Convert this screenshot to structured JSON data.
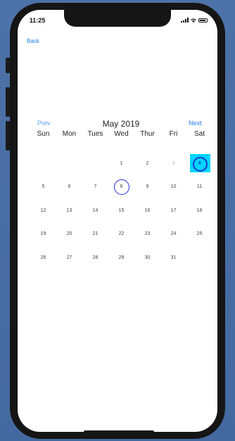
{
  "status_bar": {
    "time": "11:25"
  },
  "nav": {
    "back_label": "Back"
  },
  "calendar": {
    "prev_label": "Prev",
    "next_label": "Next",
    "month_title": "May 2019",
    "weekdays": [
      "Sun",
      "Mon",
      "Tues",
      "Wed",
      "Thur",
      "Fri",
      "Sat"
    ],
    "weeks": [
      [
        "",
        "",
        "",
        "1",
        "2",
        "3",
        "4"
      ],
      [
        "5",
        "6",
        "7",
        "8",
        "9",
        "10",
        "11"
      ],
      [
        "12",
        "13",
        "14",
        "15",
        "16",
        "17",
        "18"
      ],
      [
        "19",
        "20",
        "21",
        "22",
        "23",
        "24",
        "25"
      ],
      [
        "26",
        "27",
        "28",
        "29",
        "30",
        "31",
        ""
      ]
    ],
    "today": "8",
    "selected": "4",
    "dimmed": [
      "3"
    ],
    "colors": {
      "accent": "#1f7ae8",
      "selected_fill": "#00d4ff",
      "today_ring": "#2b2bd8"
    }
  }
}
